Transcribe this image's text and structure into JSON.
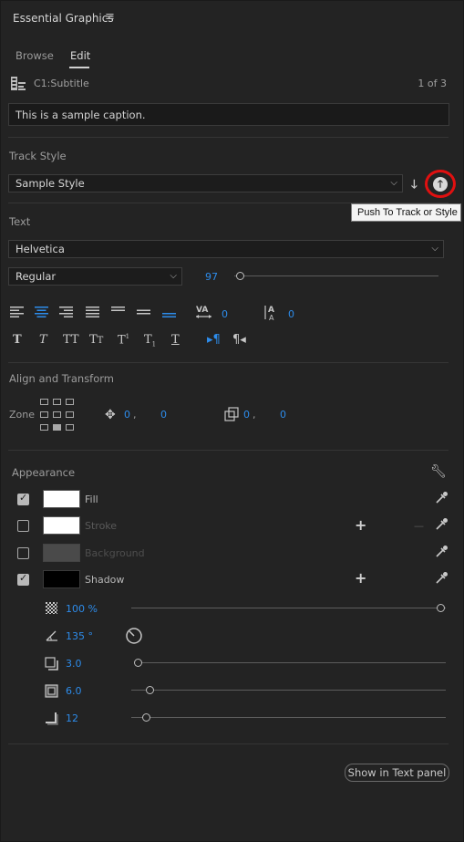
{
  "header": {
    "title": "Essential Graphics",
    "menu_icon": "hamburger-menu-icon"
  },
  "tabs": [
    {
      "label": "Browse"
    },
    {
      "label": "Edit"
    }
  ],
  "caption": {
    "track_name": "C1:Subtitle",
    "counter": "1 of 3",
    "text": "This is a sample caption."
  },
  "track_style": {
    "heading": "Track Style",
    "selected": "Sample Style",
    "tooltip": "Push To Track or Style"
  },
  "text_section": {
    "heading": "Text",
    "font": "Helvetica",
    "font_style": "Regular",
    "font_size": "97",
    "font_size_fraction": 0.0,
    "kerning": "0",
    "tracking": "0"
  },
  "align_transform": {
    "heading": "Align and Transform",
    "zone_label": "Zone",
    "pos_x": "0",
    "pos_sep": ",",
    "pos_y": "0",
    "scale_x": "0",
    "scale_sep": ",",
    "scale_y": "0"
  },
  "appearance": {
    "heading": "Appearance",
    "fill": {
      "label": "Fill",
      "checked": true,
      "color": "#ffffff"
    },
    "stroke": {
      "label": "Stroke",
      "checked": false,
      "color": "#ffffff",
      "dash": "—"
    },
    "background": {
      "label": "Background",
      "checked": false,
      "color": "#4a4a4a"
    },
    "shadow": {
      "label": "Shadow",
      "checked": true,
      "color": "#000000"
    },
    "shadow_props": {
      "opacity": "100 %",
      "opacity_fraction": 1.0,
      "angle": "135 °",
      "distance": "3.0",
      "distance_fraction": 0.0,
      "size": "6.0",
      "size_fraction": 0.05,
      "blur": "12",
      "blur_fraction": 0.04
    }
  },
  "footer": {
    "show_in_text_panel": "Show in Text panel"
  },
  "colors": {
    "accent_blue": "#2d8ceb",
    "highlight_red": "#e01010"
  }
}
